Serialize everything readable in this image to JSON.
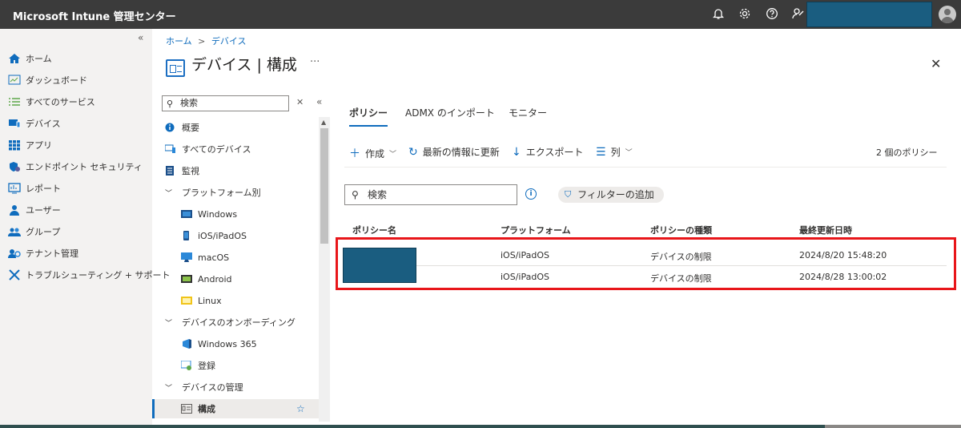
{
  "app": {
    "title": "Microsoft Intune 管理センター"
  },
  "colors": {
    "accent": "#0f6cbd",
    "topbar": "#3b3b3b",
    "highlight": "#e8161a",
    "redaction": "#1a5d80"
  },
  "topbar_icons": [
    "bell-icon",
    "gear-icon",
    "help-icon",
    "feedback-icon"
  ],
  "leftnav": {
    "collapse": "«",
    "items": [
      {
        "label": "ホーム",
        "icon": "home-icon"
      },
      {
        "label": "ダッシュボード",
        "icon": "dashboard-icon"
      },
      {
        "label": "すべてのサービス",
        "icon": "list-icon"
      },
      {
        "label": "デバイス",
        "icon": "devices-icon"
      },
      {
        "label": "アプリ",
        "icon": "apps-icon"
      },
      {
        "label": "エンドポイント セキュリティ",
        "icon": "shield-icon"
      },
      {
        "label": "レポート",
        "icon": "report-icon"
      },
      {
        "label": "ユーザー",
        "icon": "user-icon"
      },
      {
        "label": "グループ",
        "icon": "group-icon"
      },
      {
        "label": "テナント管理",
        "icon": "tenant-icon"
      },
      {
        "label": "トラブルシューティング + サポート",
        "icon": "tools-icon"
      }
    ]
  },
  "breadcrumb": {
    "home": "ホーム",
    "sep": ">",
    "current": "デバイス"
  },
  "page": {
    "title": "デバイス | 構成",
    "more": "···",
    "close": "✕"
  },
  "subnav": {
    "search_placeholder": "検索",
    "items": [
      {
        "label": "概要"
      },
      {
        "label": "すべてのデバイス"
      },
      {
        "label": "監視"
      },
      {
        "label": "プラットフォーム別"
      },
      {
        "label": "Windows"
      },
      {
        "label": "iOS/iPadOS"
      },
      {
        "label": "macOS"
      },
      {
        "label": "Android"
      },
      {
        "label": "Linux"
      },
      {
        "label": "デバイスのオンボーディング"
      },
      {
        "label": "Windows 365"
      },
      {
        "label": "登録"
      },
      {
        "label": "デバイスの管理"
      },
      {
        "label": "構成"
      }
    ]
  },
  "tabs": [
    {
      "label": "ポリシー",
      "active": true
    },
    {
      "label": "ADMX のインポート",
      "active": false
    },
    {
      "label": "モニター",
      "active": false
    }
  ],
  "toolbar": {
    "create": "作成",
    "refresh": "最新の情報に更新",
    "export": "エクスポート",
    "columns": "列",
    "count": "2 個のポリシー"
  },
  "filter": {
    "search_placeholder": "検索",
    "add_filter": "フィルターの追加"
  },
  "table": {
    "headers": [
      "ポリシー名",
      "プラットフォーム",
      "ポリシーの種類",
      "最終更新日時"
    ],
    "rows": [
      {
        "name": "",
        "platform": "iOS/iPadOS",
        "type": "デバイスの制限",
        "modified": "2024/8/20 15:48:20"
      },
      {
        "name": "",
        "platform": "iOS/iPadOS",
        "type": "デバイスの制限",
        "modified": "2024/8/28 13:00:02"
      }
    ]
  }
}
